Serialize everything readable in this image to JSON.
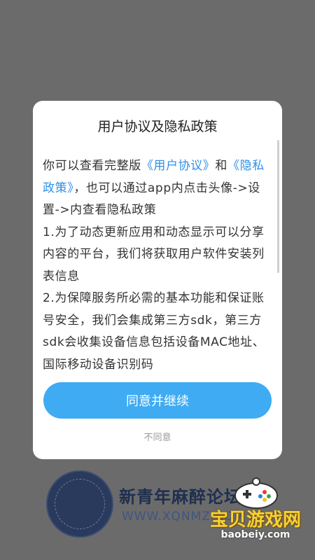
{
  "dialog": {
    "title": "用户协议及隐私政策",
    "body": {
      "intro_prefix": "你可以查看完整版",
      "user_agreement_link": "《用户协议》",
      "intro_and": "和",
      "privacy_policy_link": "《隐私政策》",
      "intro_suffix": "，也可以通过app内点击头像->设置->内查看隐私政策",
      "item1": "1.为了动态更新应用和动态显示可以分享内容的平台，我们将获取用户软件安装列表信息",
      "item2": "2.为保障服务所必需的基本功能和保证账号安全，我们会集成第三方sdk，第三方sdk会收集设备信息包括设备MAC地址、国际移动设备识别码"
    },
    "agree_label": "同意并继续",
    "disagree_label": "不同意"
  },
  "background": {
    "brand_name": "新青年麻醉论坛",
    "site_url": "WWW.XQNMZ.COM",
    "seal_text": "新青年麻醉论坛"
  },
  "watermark": {
    "title": "宝贝游戏网",
    "url": "baobeiy.com"
  },
  "colors": {
    "overlay": "#6b6b6b",
    "accent": "#3fabf3",
    "link": "#2f8fe8",
    "watermark_title": "#f6d234"
  }
}
